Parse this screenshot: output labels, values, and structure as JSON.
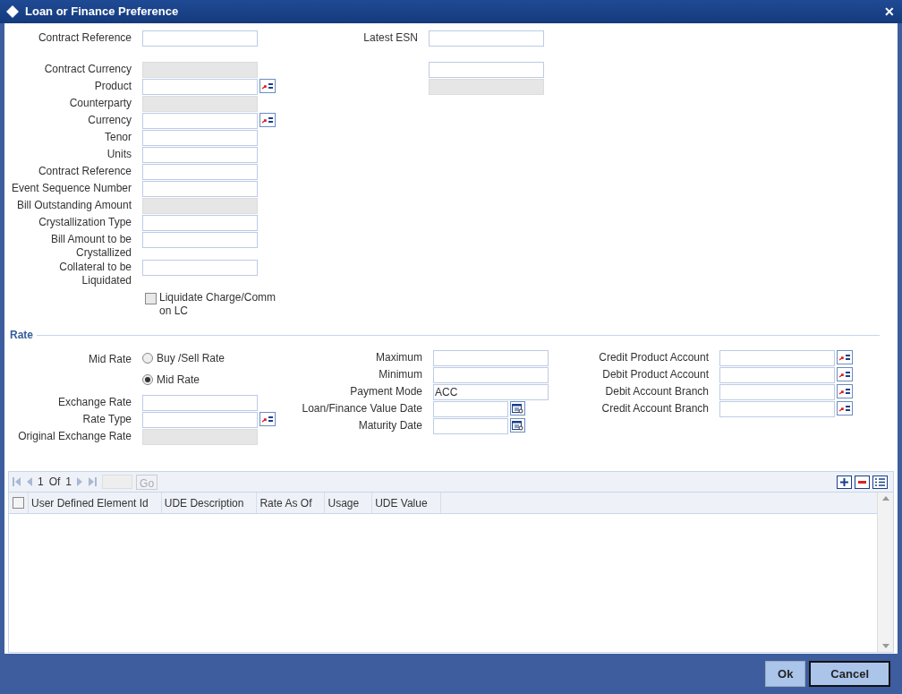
{
  "window": {
    "title": "Loan or Finance Preference",
    "close": "✕"
  },
  "top_left": [
    {
      "label": "Contract Reference",
      "kind": "text",
      "disabled": false
    },
    {
      "kind": "spacer"
    },
    {
      "label": "Contract Currency",
      "kind": "text",
      "disabled": true
    },
    {
      "label": "Product",
      "kind": "lookup",
      "disabled": false
    },
    {
      "label": "Counterparty",
      "kind": "text",
      "disabled": true
    },
    {
      "label": "Currency",
      "kind": "lookup",
      "disabled": false
    },
    {
      "label": "Tenor",
      "kind": "text",
      "disabled": false
    },
    {
      "label": "Units",
      "kind": "text",
      "disabled": false
    },
    {
      "label": "Contract Reference",
      "kind": "text",
      "disabled": false
    },
    {
      "label": "Event Sequence Number",
      "kind": "text",
      "disabled": false
    },
    {
      "label": "Bill Outstanding Amount",
      "kind": "text",
      "disabled": true
    },
    {
      "label": "Crystallization Type",
      "kind": "text",
      "disabled": false
    },
    {
      "label": "Bill Amount to be Crystallized",
      "kind": "text",
      "disabled": false
    },
    {
      "label": "Collateral to be Liquidated",
      "kind": "text",
      "disabled": false
    }
  ],
  "liquidate_checkbox": {
    "label": "Liquidate Charge/Comm on LC",
    "checked": false
  },
  "top_right": [
    {
      "label": "Latest ESN",
      "kind": "text",
      "disabled": false
    },
    {
      "kind": "spacer"
    },
    {
      "kind": "text",
      "disabled": false
    },
    {
      "kind": "text",
      "disabled": true
    }
  ],
  "rate": {
    "title": "Rate",
    "radio_label": "Mid Rate",
    "radios": [
      {
        "label": "Buy /Sell Rate",
        "selected": false
      },
      {
        "label": "Mid Rate",
        "selected": true
      }
    ],
    "left": [
      {
        "label": "Exchange Rate",
        "kind": "text",
        "disabled": false
      },
      {
        "label": "Rate Type",
        "kind": "lookup",
        "disabled": false
      },
      {
        "label": "Original Exchange Rate",
        "kind": "text",
        "disabled": true
      }
    ],
    "middle": [
      {
        "label": "Maximum",
        "kind": "text",
        "disabled": false
      },
      {
        "label": "Minimum",
        "kind": "text",
        "disabled": false
      },
      {
        "label": "Payment Mode",
        "kind": "text",
        "disabled": false,
        "value": "ACC"
      },
      {
        "label": "Loan/Finance Value Date",
        "kind": "date",
        "disabled": false
      },
      {
        "label": "Maturity Date",
        "kind": "date",
        "disabled": false
      }
    ],
    "right": [
      {
        "label": "Credit Product Account",
        "kind": "lookup",
        "disabled": false
      },
      {
        "label": "Debit Product Account",
        "kind": "lookup",
        "disabled": false
      },
      {
        "label": "Debit Account Branch",
        "kind": "lookup",
        "disabled": false
      },
      {
        "label": "Credit Account Branch",
        "kind": "lookup",
        "disabled": false
      }
    ]
  },
  "grid": {
    "pager": {
      "page": "1",
      "of": "Of",
      "total": "1",
      "go": "Go"
    },
    "columns": [
      "User Defined Element Id",
      "UDE Description",
      "Rate As Of",
      "Usage",
      "UDE Value"
    ],
    "select_all": {
      "checked": false
    }
  },
  "buttons": [
    {
      "label": "Ok",
      "focused": false
    },
    {
      "label": "Cancel",
      "focused": true
    }
  ]
}
